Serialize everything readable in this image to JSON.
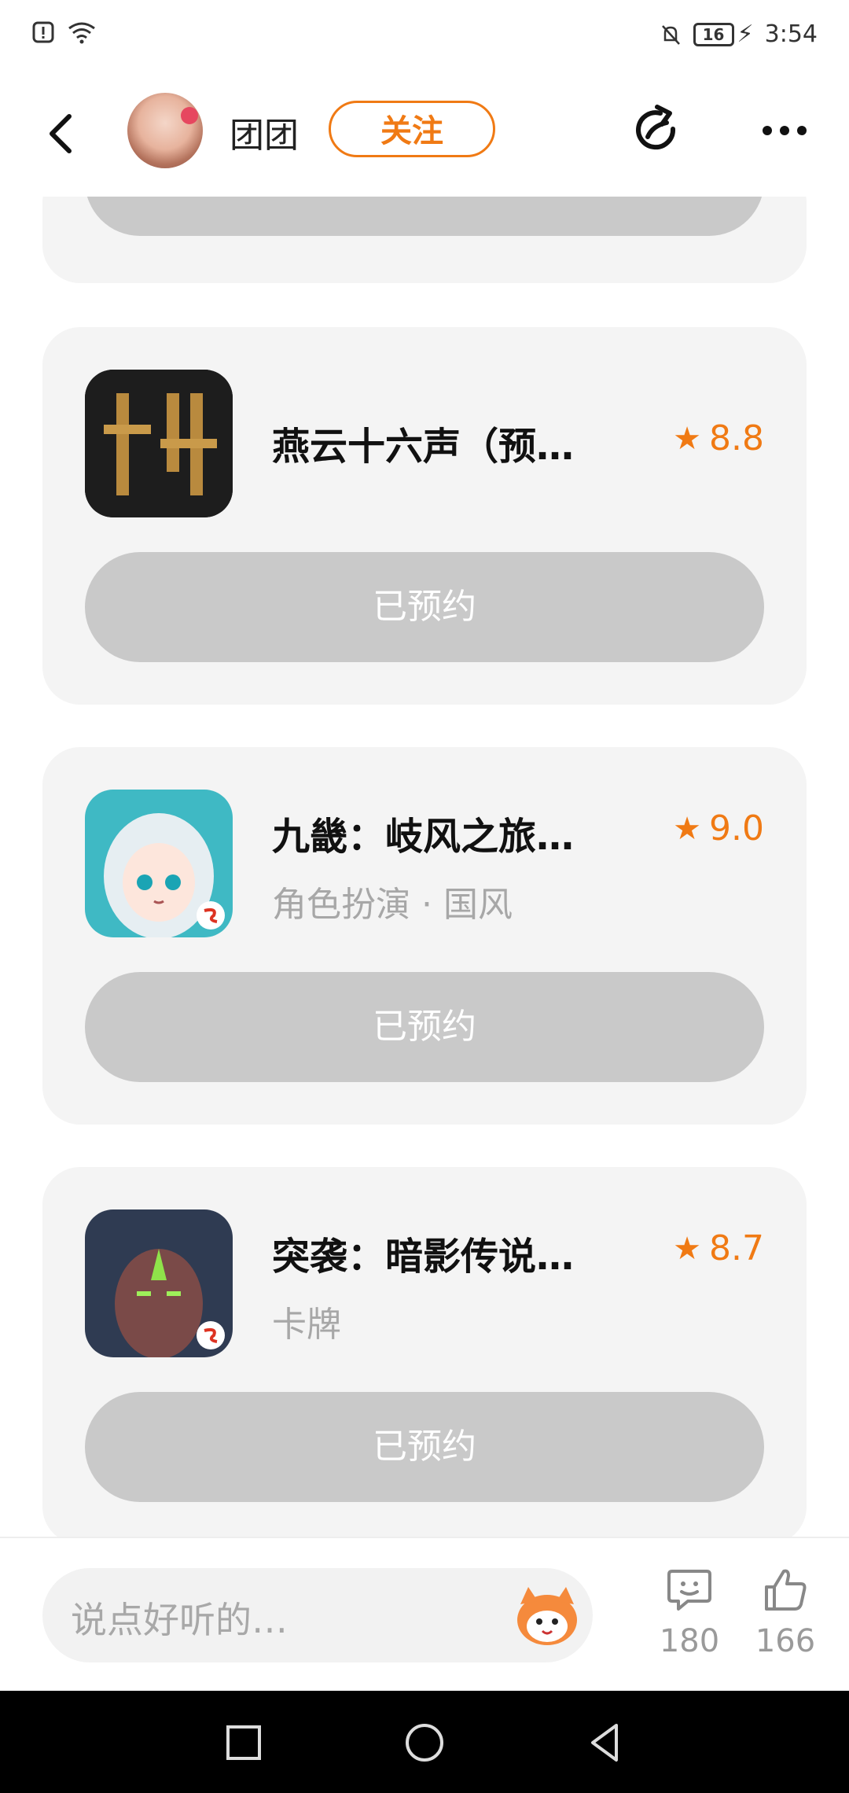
{
  "status_bar": {
    "time": "3:54",
    "battery": "16"
  },
  "header": {
    "nickname": "团团",
    "follow_label": "关注"
  },
  "games": [
    {
      "title": "燕云十六声（预…",
      "rating": "8.8",
      "tags": "",
      "button": "已预约"
    },
    {
      "title": "九畿：岐风之旅…",
      "rating": "9.0",
      "tags": "角色扮演 · 国风",
      "button": "已预约"
    },
    {
      "title": "突袭：暗影传说…",
      "rating": "8.7",
      "tags": "卡牌",
      "button": "已预约"
    }
  ],
  "bottom_bar": {
    "comment_placeholder": "说点好听的…",
    "comments_count": "180",
    "likes_count": "166"
  },
  "colors": {
    "accent": "#f07a14",
    "card_bg": "#f4f4f4",
    "button_bg": "#c9c9c9"
  }
}
